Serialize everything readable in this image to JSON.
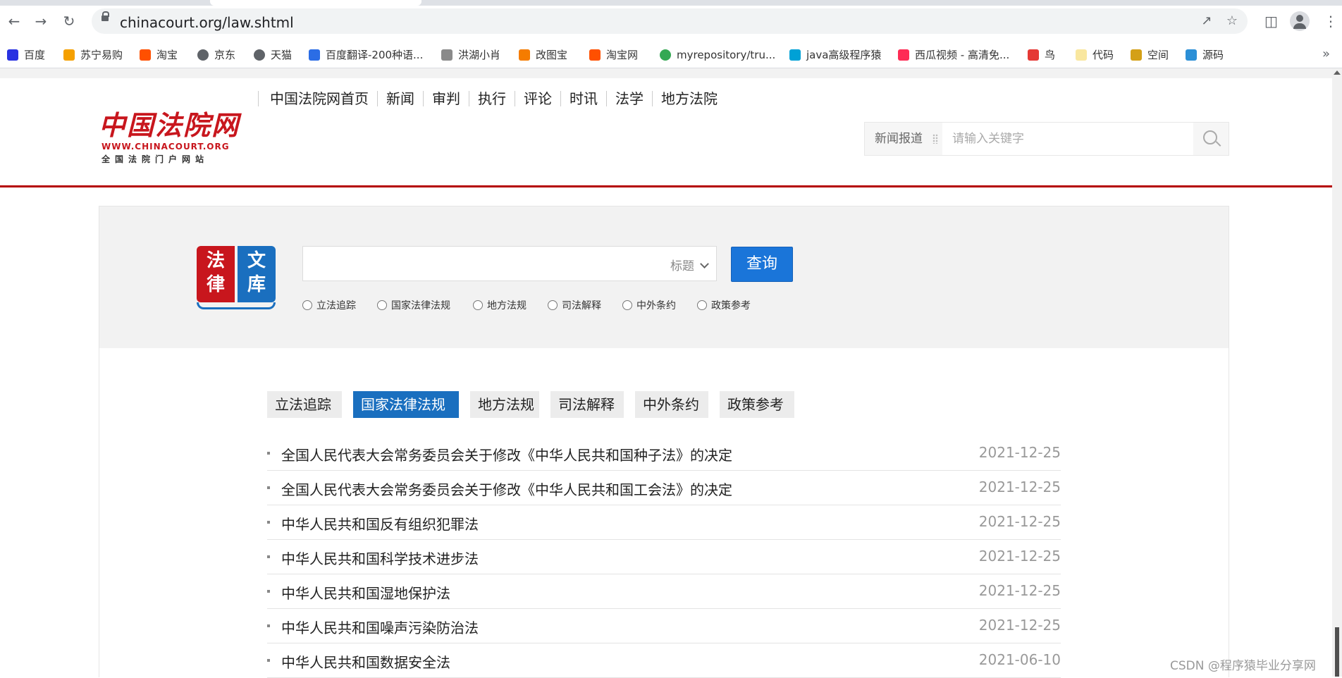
{
  "browser": {
    "url": "chinacourt.org/law.shtml",
    "bookmarks": [
      {
        "label": "百度",
        "icon": "baidu-icon",
        "color": "#2932e1"
      },
      {
        "label": "苏宁易购",
        "icon": "suning-icon",
        "color": "#f5a000"
      },
      {
        "label": "淘宝",
        "icon": "taobao-icon",
        "color": "#ff5000"
      },
      {
        "label": "京东",
        "icon": "globe-icon",
        "color": "#5f6368"
      },
      {
        "label": "天猫",
        "icon": "globe-icon",
        "color": "#5f6368"
      },
      {
        "label": "百度翻译-200种语...",
        "icon": "translate-icon",
        "color": "#2b6de5"
      },
      {
        "label": "洪湖小肖",
        "icon": "bird-icon",
        "color": "#8a8a8a"
      },
      {
        "label": "改图宝",
        "icon": "gaitubao-icon",
        "color": "#f57c00"
      },
      {
        "label": "淘宝网",
        "icon": "taobao-icon",
        "color": "#ff5000"
      },
      {
        "label": "myrepository/tru...",
        "icon": "chrome-icon",
        "color": "#34a853"
      },
      {
        "label": "java高级程序猿",
        "icon": "bilibili-icon",
        "color": "#00a1d6"
      },
      {
        "label": "西瓜视频 - 高清免...",
        "icon": "xigua-icon",
        "color": "#fe2c55"
      },
      {
        "label": "鸟",
        "icon": "bird-icon",
        "color": "#e53935"
      },
      {
        "label": "代码",
        "icon": "code-icon",
        "color": "#f9e79f"
      },
      {
        "label": "空间",
        "icon": "space-icon",
        "color": "#d4a017"
      },
      {
        "label": "源码",
        "icon": "fish-icon",
        "color": "#2b8fd6"
      }
    ]
  },
  "site": {
    "logo_main": "中国法院网",
    "logo_url": "WWW.CHINACOURT.ORG",
    "logo_sub": "全国法院门户网站",
    "nav": [
      "中国法院网首页",
      "新闻",
      "审判",
      "执行",
      "评论",
      "时讯",
      "法学",
      "地方法院"
    ],
    "search": {
      "category": "新闻报道",
      "placeholder": "请输入关键字"
    }
  },
  "law_library": {
    "logo_chars": [
      "法",
      "文",
      "律",
      "库"
    ],
    "query_field": "标题",
    "query_button": "查询",
    "radio_options": [
      "立法追踪",
      "国家法律法规",
      "地方法规",
      "司法解释",
      "中外条约",
      "政策参考"
    ],
    "tabs": [
      "立法追踪",
      "国家法律法规",
      "地方法规",
      "司法解释",
      "中外条约",
      "政策参考"
    ],
    "active_tab": "国家法律法规",
    "items": [
      {
        "title": "全国人民代表大会常务委员会关于修改《中华人民共和国种子法》的决定",
        "date": "2021-12-25"
      },
      {
        "title": "全国人民代表大会常务委员会关于修改《中华人民共和国工会法》的决定",
        "date": "2021-12-25"
      },
      {
        "title": "中华人民共和国反有组织犯罪法",
        "date": "2021-12-25"
      },
      {
        "title": "中华人民共和国科学技术进步法",
        "date": "2021-12-25"
      },
      {
        "title": "中华人民共和国湿地保护法",
        "date": "2021-12-25"
      },
      {
        "title": "中华人民共和国噪声污染防治法",
        "date": "2021-12-25"
      },
      {
        "title": "中华人民共和国数据安全法",
        "date": "2021-06-10"
      }
    ]
  },
  "watermark": "CSDN @程序猿毕业分享网",
  "colors": {
    "brand_red": "#b40000",
    "accent_blue": "#1a6fbf",
    "query_blue": "#1a75d9"
  }
}
